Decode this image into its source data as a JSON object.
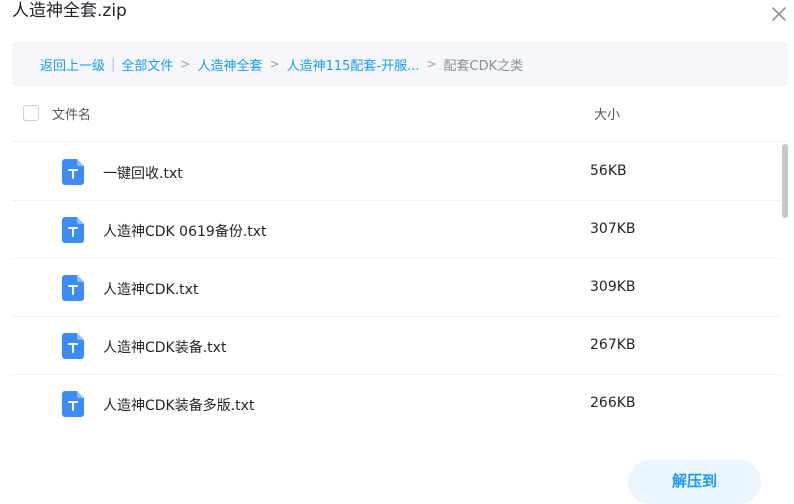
{
  "window": {
    "title": "人造神全套.zip"
  },
  "breadcrumb": {
    "back": "返回上一级",
    "items": [
      "全部文件",
      "人造神全套",
      "人造神115配套-开服...",
      "配套CDK之类"
    ]
  },
  "table": {
    "columns": {
      "name": "文件名",
      "size": "大小"
    },
    "rows": [
      {
        "name": "一键回收.txt",
        "size": "56KB",
        "icon": "text-file-icon"
      },
      {
        "name": "人造神CDK 0619备份.txt",
        "size": "307KB",
        "icon": "text-file-icon"
      },
      {
        "name": "人造神CDK.txt",
        "size": "309KB",
        "icon": "text-file-icon"
      },
      {
        "name": "人造神CDK装备.txt",
        "size": "267KB",
        "icon": "text-file-icon"
      },
      {
        "name": "人造神CDK装备多版.txt",
        "size": "266KB",
        "icon": "text-file-icon"
      }
    ]
  },
  "footer": {
    "extract_label": "解压到"
  },
  "colors": {
    "accent": "#1a9bf2",
    "file_icon": "#3d8bf7",
    "button_bg": "#eaf4ff",
    "breadcrumb_bg": "#f4f6f9"
  }
}
